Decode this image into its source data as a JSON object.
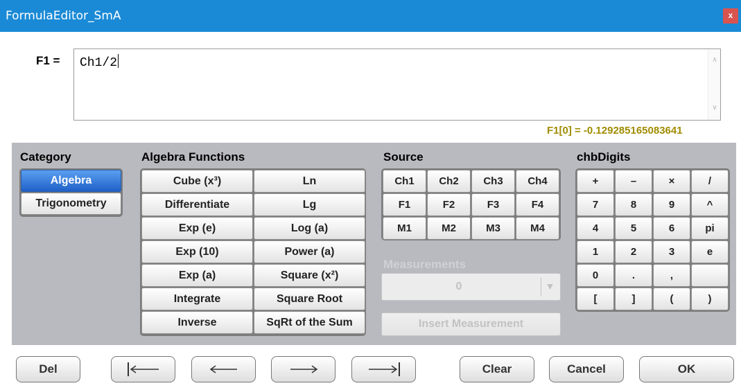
{
  "window": {
    "title": "FormulaEditor_SmA",
    "close_label": "x"
  },
  "editor": {
    "label": "F1 =",
    "value": "Ch1/2"
  },
  "result": "F1[0] = -0.129285165083641",
  "category": {
    "header": "Category",
    "items": [
      {
        "label": "Algebra",
        "selected": true
      },
      {
        "label": "Trigonometry",
        "selected": false
      }
    ]
  },
  "algebra": {
    "header": "Algebra Functions",
    "rows": [
      [
        "Cube (x³)",
        "Ln"
      ],
      [
        "Differentiate",
        "Lg"
      ],
      [
        "Exp (e)",
        "Log (a)"
      ],
      [
        "Exp (10)",
        "Power (a)"
      ],
      [
        "Exp (a)",
        "Square (x²)"
      ],
      [
        "Integrate",
        "Square Root"
      ],
      [
        "Inverse",
        "SqRt of the Sum"
      ]
    ]
  },
  "source": {
    "header": "Source",
    "rows": [
      [
        "Ch1",
        "Ch2",
        "Ch3",
        "Ch4"
      ],
      [
        "F1",
        "F2",
        "F3",
        "F4"
      ],
      [
        "M1",
        "M2",
        "M3",
        "M4"
      ]
    ]
  },
  "measurements": {
    "header": "Measurements",
    "selected": "0",
    "insert_label": "Insert Measurement"
  },
  "digits": {
    "header": "chbDigits",
    "rows": [
      [
        "+",
        "–",
        "×",
        "/"
      ],
      [
        "7",
        "8",
        "9",
        "^"
      ],
      [
        "4",
        "5",
        "6",
        "pi"
      ],
      [
        "1",
        "2",
        "3",
        "e"
      ],
      [
        "0",
        ".",
        ",",
        ""
      ],
      [
        "[",
        "]",
        "(",
        ")"
      ]
    ]
  },
  "bottom": {
    "del": "Del",
    "clear": "Clear",
    "cancel": "Cancel",
    "ok": "OK"
  },
  "colors": {
    "title_bar": "#1a8ad6",
    "panel": "#b9b9c0",
    "result_text": "#a08c00",
    "selected": "#1f60c8"
  }
}
